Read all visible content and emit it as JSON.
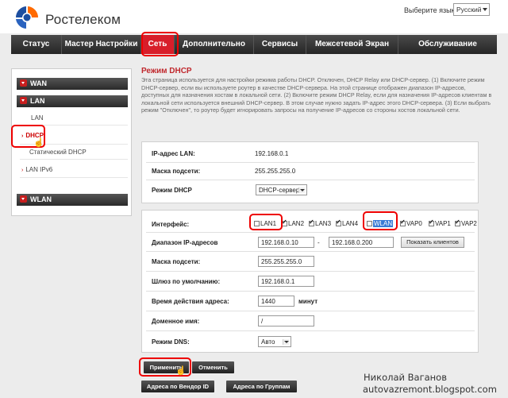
{
  "header": {
    "logo_text": "Ростелеком",
    "language_label": "Выберите язык:",
    "language_value": "Русский"
  },
  "nav": {
    "items": [
      {
        "label": "Статус"
      },
      {
        "label": "Мастер Настройки"
      },
      {
        "label": "Сеть"
      },
      {
        "label": "Дополнительно"
      },
      {
        "label": "Сервисы"
      },
      {
        "label": "Межсетевой Экран"
      },
      {
        "label": "Обслуживание"
      }
    ],
    "active_index": 2
  },
  "sidebar": {
    "wan": "WAN",
    "lan": "LAN",
    "lan_items": [
      {
        "label": "LAN"
      },
      {
        "label": "DHCP"
      },
      {
        "label": "Статический DHCP"
      },
      {
        "label": "LAN IPv6"
      }
    ],
    "wlan": "WLAN"
  },
  "main": {
    "title": "Режим DHCP",
    "description": "Эта страница используется для настройки режима работы DHCP. Отключен, DHCP Relay или DHCP-сервер. (1) Включите режим DHCP-сервер, если вы используете роутер в качестве DHCP-сервера. На этой странице отображен диапазон IP-адресов, доступных для назначения хостам в локальной сети. (2) Включите режим DHCP Relay, если для назначения IP-адресов клиентам в локальной сети используется внешний DHCP-сервер. В этом случае нужно задать IP-адрес этого DHCP-сервера. (3) Если выбрать режим \"Отключен\", то роутер будет игнорировать запросы на получение IP-адресов со стороны хостов локальной сети.",
    "lan_ip_label": "IP-адрес LAN:",
    "lan_ip_value": "192.168.0.1",
    "subnet_label": "Маска подсети:",
    "subnet_value": "255.255.255.0",
    "dhcp_mode_label": "Режим DHCP",
    "dhcp_mode_value": "DHCP-сервер",
    "interface_label": "Интерфейс:",
    "interfaces": [
      {
        "label": "LAN1",
        "checked": false
      },
      {
        "label": "LAN2",
        "checked": true
      },
      {
        "label": "LAN3",
        "checked": true
      },
      {
        "label": "LAN4",
        "checked": true
      },
      {
        "label": "WLAN",
        "checked": false
      },
      {
        "label": "VAP0",
        "checked": true
      },
      {
        "label": "VAP1",
        "checked": true
      },
      {
        "label": "VAP2",
        "checked": true
      }
    ],
    "range_label": "Диапазон IP-адресов",
    "range_start": "192.168.0.10",
    "range_dash": "-",
    "range_end": "192.168.0.200",
    "show_clients": "Показать клиентов",
    "mask_label": "Маска подсети:",
    "mask_value": "255.255.255.0",
    "gateway_label": "Шлюз по умолчанию:",
    "gateway_value": "192.168.0.1",
    "lease_label": "Время действия адреса:",
    "lease_value": "1440",
    "lease_unit": "минут",
    "domain_label": "Доменное имя:",
    "domain_value": "/",
    "dns_label": "Режим DNS:",
    "dns_value": "Авто"
  },
  "buttons": {
    "apply": "Применить",
    "cancel": "Отменить",
    "vendor": "Адреса по Вендор ID",
    "groups": "Адреса по Группам"
  },
  "watermark": {
    "line1": "Николай Ваганов",
    "line2": "autovazremont.blogspot.com"
  },
  "colors": {
    "brand_red": "#d81e2a",
    "highlight_red": "#ee0000",
    "title_red": "#c0282d"
  }
}
